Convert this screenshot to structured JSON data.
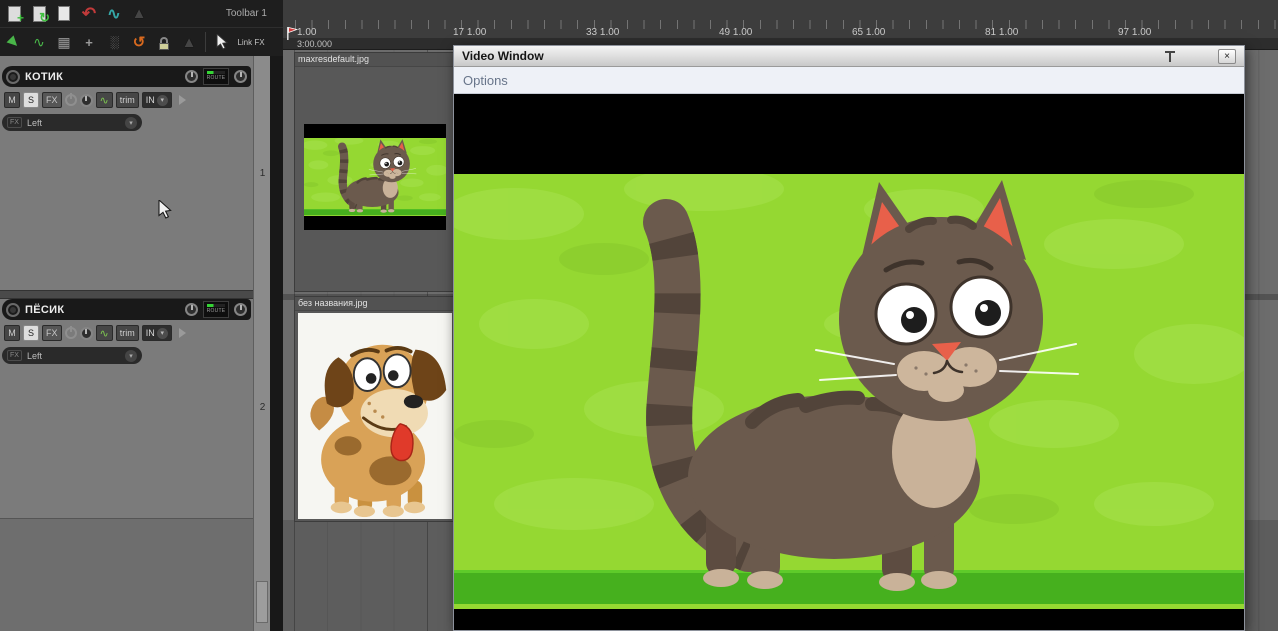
{
  "toolbar": {
    "label": "Toolbar 1",
    "link_fx": "Link FX",
    "row1_icons": [
      "new-file-icon",
      "sync-project-icon",
      "page-icon",
      "undo-icon",
      "draw-curve-icon",
      "metronome-icon"
    ],
    "row2_icons": [
      "play-cursor-icon",
      "envelope-icon",
      "routing-grid-icon",
      "move-icon",
      "grid-dots-icon",
      "loop-icon",
      "lock-icon",
      "metronome-small-icon",
      "mouse-pointer-icon"
    ]
  },
  "tracks": [
    {
      "name": "КОТИК",
      "number": "1",
      "mute": "M",
      "solo": "S",
      "fx": "FX",
      "trim": "trim",
      "input": "IN",
      "route": "ROUTE",
      "channel_fx": "FX",
      "channel": "Left"
    },
    {
      "name": "ПЁСИК",
      "number": "2",
      "mute": "M",
      "solo": "S",
      "fx": "FX",
      "trim": "trim",
      "input": "IN",
      "route": "ROUTE",
      "channel_fx": "FX",
      "channel": "Left"
    }
  ],
  "timeline": {
    "markers": [
      "1.00",
      "17 1.00",
      "33 1.00",
      "49 1.00",
      "65 1.00",
      "81 1.00",
      "97 1.00"
    ],
    "cursor_time": "3:00.000"
  },
  "items": [
    {
      "label": "maxresdefault.jpg"
    },
    {
      "label": "без названия.jpg"
    }
  ],
  "video_window": {
    "title": "Video Window",
    "menu_options": "Options",
    "close": "×"
  },
  "colors": {
    "video_bg_green": "#95d832",
    "ground_green": "#46b01e",
    "cat_fur": "#6b5a4d",
    "cat_fur_dark": "#52443a",
    "cat_fur_light": "#c9b299",
    "ear_inner": "#e8604a",
    "panel_gray": "#7b7b7b",
    "toolbar_bg": "#1e1e1e"
  }
}
